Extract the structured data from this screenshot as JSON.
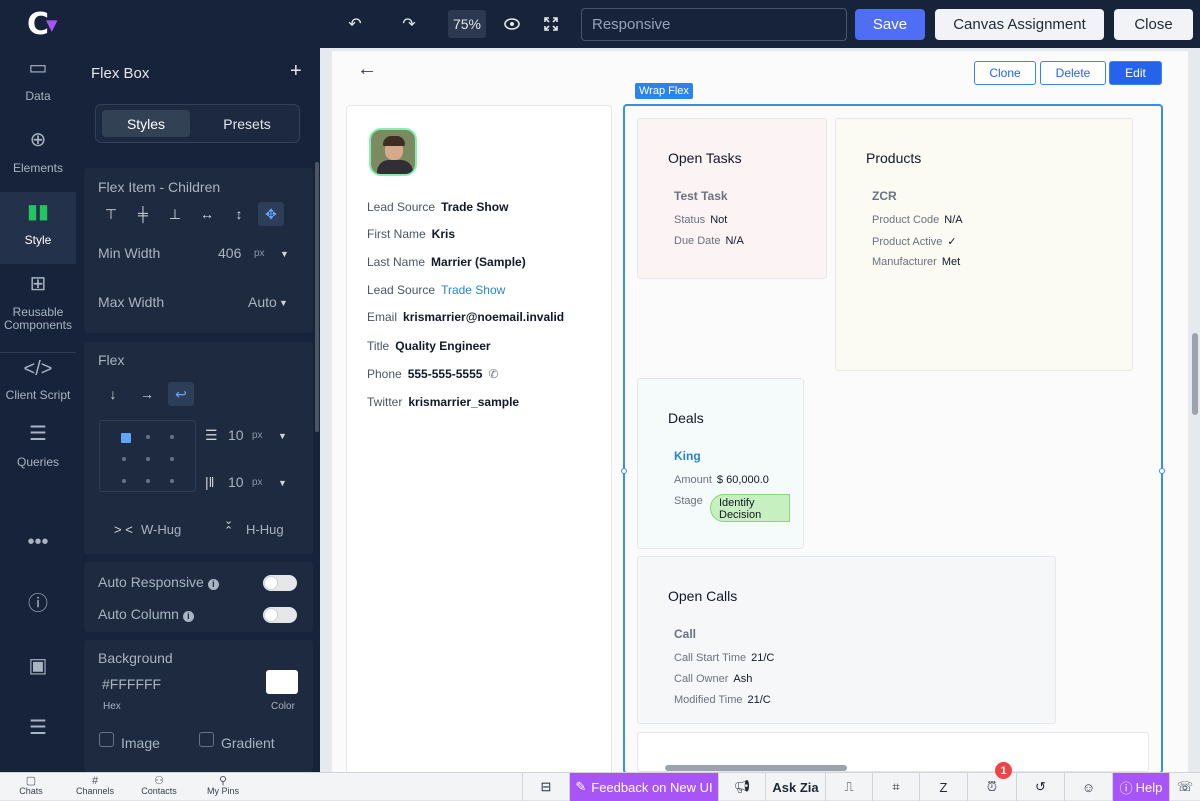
{
  "app": {
    "logo_text": "C"
  },
  "toolbar": {
    "zoom": "75%",
    "search_placeholder": "Responsive",
    "save_label": "Save",
    "canvas_assignment_label": "Canvas Assignment",
    "close_label": "Close"
  },
  "rail": {
    "items": [
      {
        "label": "Data",
        "icon": "data-icon"
      },
      {
        "label": "Elements",
        "icon": "plus-circle-icon"
      },
      {
        "label": "Style",
        "icon": "style-icon"
      },
      {
        "label": "Reusable Components",
        "icon": "components-icon"
      },
      {
        "label": "Client Script",
        "icon": "code-icon"
      },
      {
        "label": "Queries",
        "icon": "database-icon"
      }
    ]
  },
  "panel": {
    "title": "Flex Box",
    "tabs": [
      "Styles",
      "Presets"
    ],
    "flex_item": {
      "heading": "Flex Item - Children",
      "min_width_label": "Min Width",
      "min_width_value": "406",
      "unit": "px",
      "max_width_label": "Max Width",
      "max_width_value": "Auto"
    },
    "flex": {
      "heading": "Flex",
      "row_gap": "10",
      "col_gap": "10",
      "unit": "px",
      "w_hug": "W-Hug",
      "h_hug": "H-Hug"
    },
    "auto_responsive_label": "Auto Responsive",
    "auto_column_label": "Auto Column",
    "background": {
      "heading": "Background",
      "hex": "#FFFFFF",
      "hex_label": "Hex",
      "color_label": "Color",
      "image_label": "Image",
      "gradient_label": "Gradient",
      "swatch": "#FFFFFF"
    }
  },
  "canvas": {
    "actions": [
      "Clone",
      "Delete",
      "Edit"
    ],
    "wrap_label": "Wrap Flex",
    "lead": {
      "fields": [
        {
          "label": "Lead Source",
          "value": "Trade Show",
          "link": false
        },
        {
          "label": "First Name",
          "value": "Kris",
          "link": false
        },
        {
          "label": "Last Name",
          "value": "Marrier (Sample)",
          "link": false
        },
        {
          "label": "Lead Source",
          "value": "Trade Show",
          "link": true
        },
        {
          "label": "Email",
          "value": "krismarrier@noemail.invalid",
          "link": false
        },
        {
          "label": "Title",
          "value": "Quality Engineer",
          "link": false
        },
        {
          "label": "Phone",
          "value": "555-555-5555",
          "link": false
        },
        {
          "label": "Twitter",
          "value": "krismarrier_sample",
          "link": false
        }
      ]
    },
    "open_tasks": {
      "title": "Open Tasks",
      "record": "Test Task",
      "rows": [
        {
          "label": "Status",
          "value": "Not"
        },
        {
          "label": "Due Date",
          "value": "N/A"
        }
      ]
    },
    "products": {
      "title": "Products",
      "record": "ZCR",
      "rows": [
        {
          "label": "Product Code",
          "value": "N/A"
        },
        {
          "label": "Product Active",
          "value": "✓"
        },
        {
          "label": "Manufacturer",
          "value": "Met"
        }
      ]
    },
    "deals": {
      "title": "Deals",
      "record": "King",
      "rows": [
        {
          "label": "Amount",
          "value": "$ 60,000.0"
        },
        {
          "label": "Stage",
          "value": ""
        }
      ],
      "stage_value": "Identify Decision Makers"
    },
    "open_calls": {
      "title": "Open Calls",
      "record": "Call",
      "rows": [
        {
          "label": "Call Start Time",
          "value": "21/C"
        },
        {
          "label": "Call Owner",
          "value": "Ash"
        },
        {
          "label": "Modified Time",
          "value": "21/C"
        }
      ]
    }
  },
  "bottombar": {
    "left": [
      {
        "label": "Chats",
        "icon": "chat-icon"
      },
      {
        "label": "Channels",
        "icon": "hash-icon"
      },
      {
        "label": "Contacts",
        "icon": "contacts-icon"
      },
      {
        "label": "My Pins",
        "icon": "pin-icon"
      }
    ],
    "feedback_label": "Feedback on New UI",
    "ask_zia_label": "Ask Zia",
    "help_label": "Help",
    "notification_count": "1"
  }
}
